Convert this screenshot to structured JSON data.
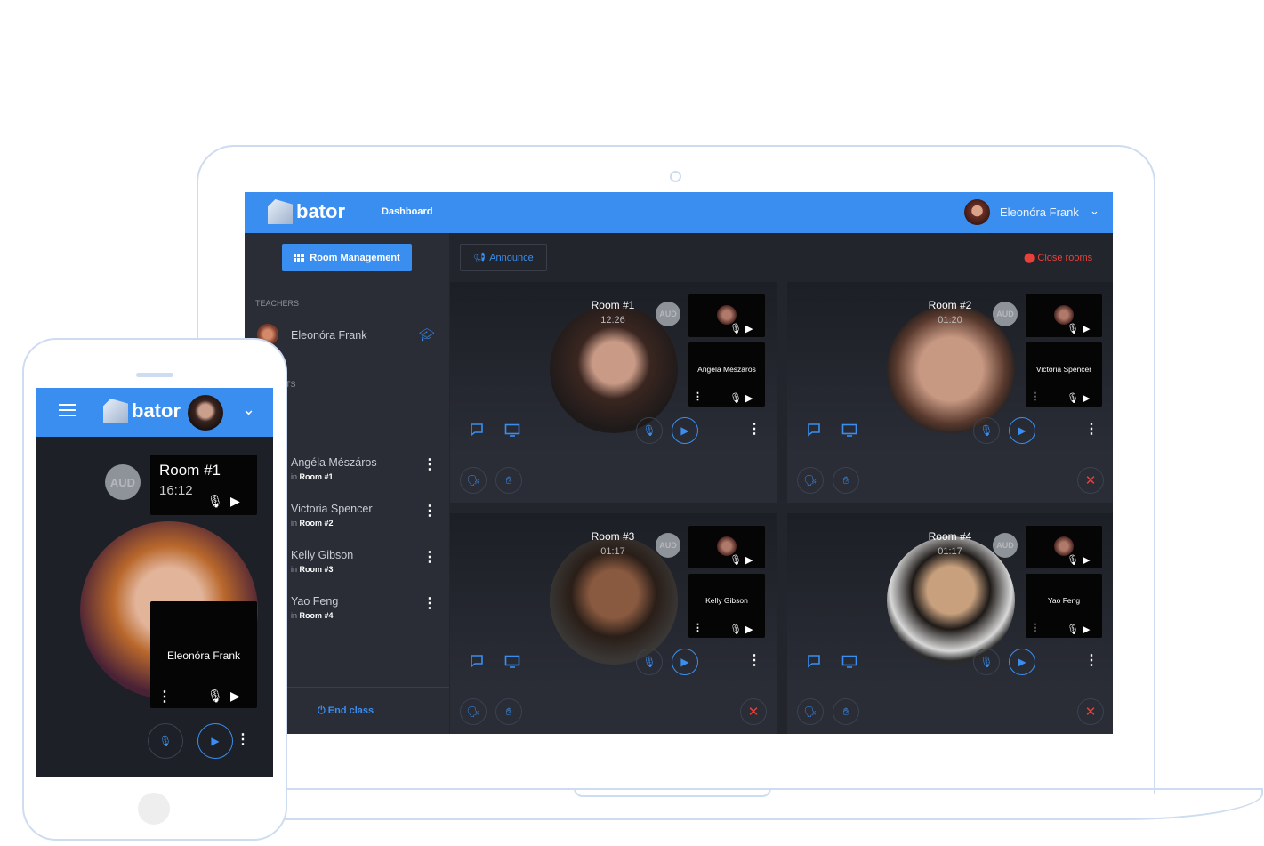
{
  "app": {
    "logo": "bator",
    "nav": "Dashboard",
    "user": "Eleonóra Frank",
    "brand_color": "#3a8ef0"
  },
  "toolbar": {
    "room_management": "Room Management",
    "announce": "Announce",
    "close_rooms": "Close rooms"
  },
  "sidebar": {
    "teachers_label": "TEACHERS",
    "teacher": {
      "name": "Eleonóra Frank",
      "icon": "graduation-cap-icon"
    },
    "students_label": "TS",
    "students": [
      {
        "name": "Angéla Mészáros",
        "prefix": "in",
        "room": "Room #1"
      },
      {
        "name": "Victoria Spencer",
        "prefix": "in",
        "room": "Room #2"
      },
      {
        "name": "Kelly Gibson",
        "prefix": "in",
        "room": "Room #3"
      },
      {
        "name": "Yao Feng",
        "prefix": "in",
        "room": "Room #4"
      }
    ],
    "end_class": "End class"
  },
  "rooms": [
    {
      "title": "Room #1",
      "time": "12:26",
      "student": "Angéla Mészáros",
      "aud": "AUD",
      "closable": false
    },
    {
      "title": "Room #2",
      "time": "01:20",
      "student": "Victoria Spencer",
      "aud": "AUD",
      "closable": true
    },
    {
      "title": "Room #3",
      "time": "01:17",
      "student": "Kelly Gibson",
      "aud": "AUD",
      "closable": true
    },
    {
      "title": "Room #4",
      "time": "01:17",
      "student": "Yao Feng",
      "aud": "AUD",
      "closable": true
    }
  ],
  "phone": {
    "logo": "bator",
    "room": "Room #1",
    "time": "16:12",
    "aud": "AUD",
    "self_name": "Eleonóra Frank"
  }
}
